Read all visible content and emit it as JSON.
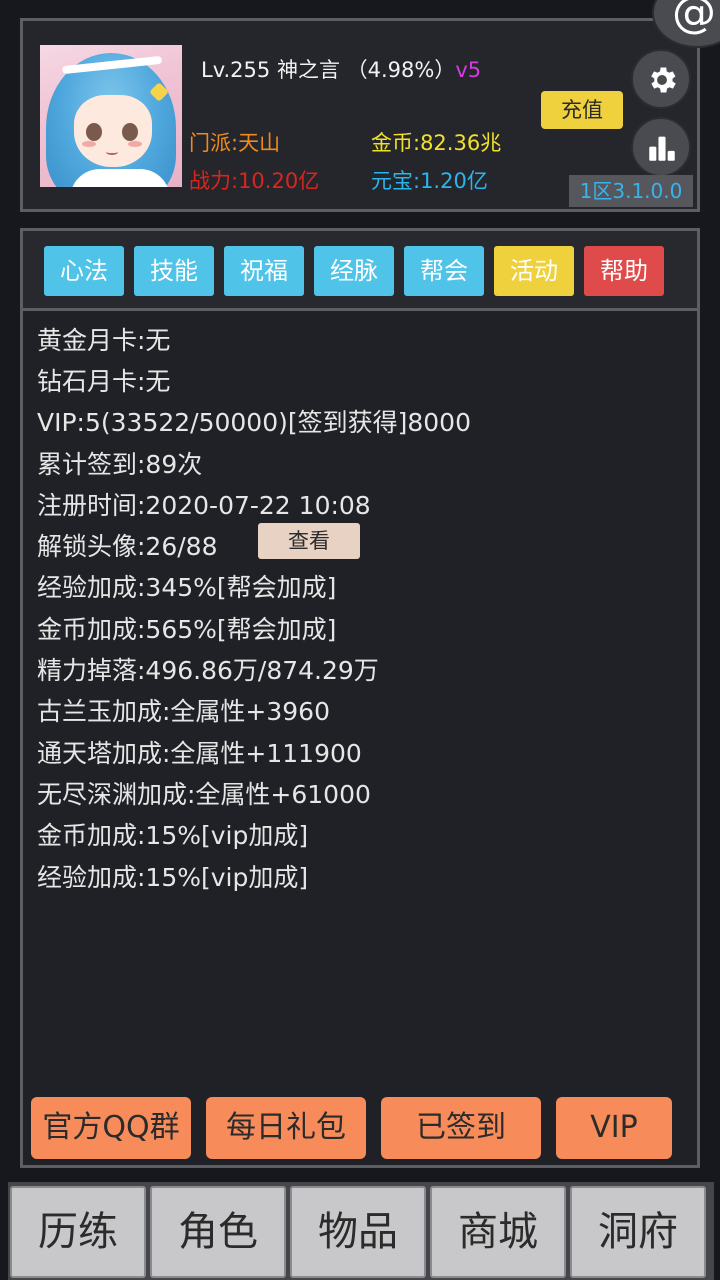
{
  "header": {
    "level": "Lv.255",
    "name": "神之言",
    "exp_percent": "（4.98%）",
    "vip_tag": "v5",
    "sect": "门派:天山",
    "gold": "金币:82.36兆",
    "power": "战力:10.20亿",
    "yuanbao": "元宝:1.20亿",
    "recharge_label": "充值",
    "server": "1区3.1.0.0",
    "at_symbol": "@"
  },
  "tabs": [
    {
      "label": "心法",
      "color": "#4fc3e8"
    },
    {
      "label": "技能",
      "color": "#4fc3e8"
    },
    {
      "label": "祝福",
      "color": "#4fc3e8"
    },
    {
      "label": "经脉",
      "color": "#4fc3e8"
    },
    {
      "label": "帮会",
      "color": "#4fc3e8"
    },
    {
      "label": "活动",
      "color": "#eed13d"
    },
    {
      "label": "帮助",
      "color": "#df4a4a"
    }
  ],
  "info": [
    "黄金月卡:无",
    "钻石月卡:无",
    "VIP:5(33522/50000)[签到获得]8000",
    "累计签到:89次",
    "注册时间:2020-07-22 10:08",
    "解锁头像:26/88",
    "经验加成:345%[帮会加成]",
    "金币加成:565%[帮会加成]",
    "精力掉落:496.86万/874.29万",
    "古兰玉加成:全属性+3960",
    "通天塔加成:全属性+111900",
    "无尽深渊加成:全属性+61000",
    "金币加成:15%[vip加成]",
    "经验加成:15%[vip加成]"
  ],
  "view_button": "查看",
  "actions": [
    "官方QQ群",
    "每日礼包",
    "已签到",
    "VIP"
  ],
  "nav": [
    "历练",
    "角色",
    "物品",
    "商城",
    "洞府"
  ]
}
